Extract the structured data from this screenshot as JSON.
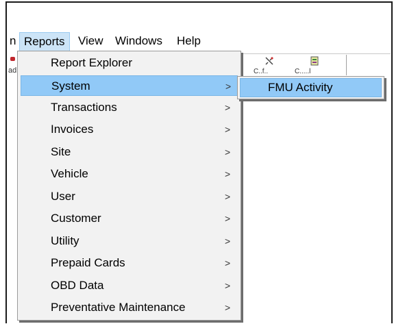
{
  "menubar": {
    "partial_label": "n",
    "items": [
      "Reports",
      "View",
      "Windows",
      "Help"
    ]
  },
  "toolbar": {
    "left_partial_text": "ad",
    "button1_icon": "wrench-icon",
    "button1_partial_label": "C..f..",
    "button2_icon": "report-icon",
    "button2_partial_label": "C.....l"
  },
  "reports_menu": {
    "items": [
      {
        "label": "Report Explorer",
        "submenu": false
      },
      {
        "label": "System",
        "submenu": true
      },
      {
        "label": "Transactions",
        "submenu": true
      },
      {
        "label": "Invoices",
        "submenu": true
      },
      {
        "label": "Site",
        "submenu": true
      },
      {
        "label": "Vehicle",
        "submenu": true
      },
      {
        "label": "User",
        "submenu": true
      },
      {
        "label": "Customer",
        "submenu": true
      },
      {
        "label": "Utility",
        "submenu": true
      },
      {
        "label": "Prepaid Cards",
        "submenu": true
      },
      {
        "label": "OBD Data",
        "submenu": true
      },
      {
        "label": "Preventative Maintenance",
        "submenu": true
      }
    ],
    "highlighted": "System",
    "arrow_glyph": ">"
  },
  "system_submenu": {
    "items": [
      "FMU Activity"
    ]
  },
  "colors": {
    "highlight": "#91c9f7",
    "menu_bg": "#f2f2f2",
    "frame": "#1a1a1a"
  }
}
